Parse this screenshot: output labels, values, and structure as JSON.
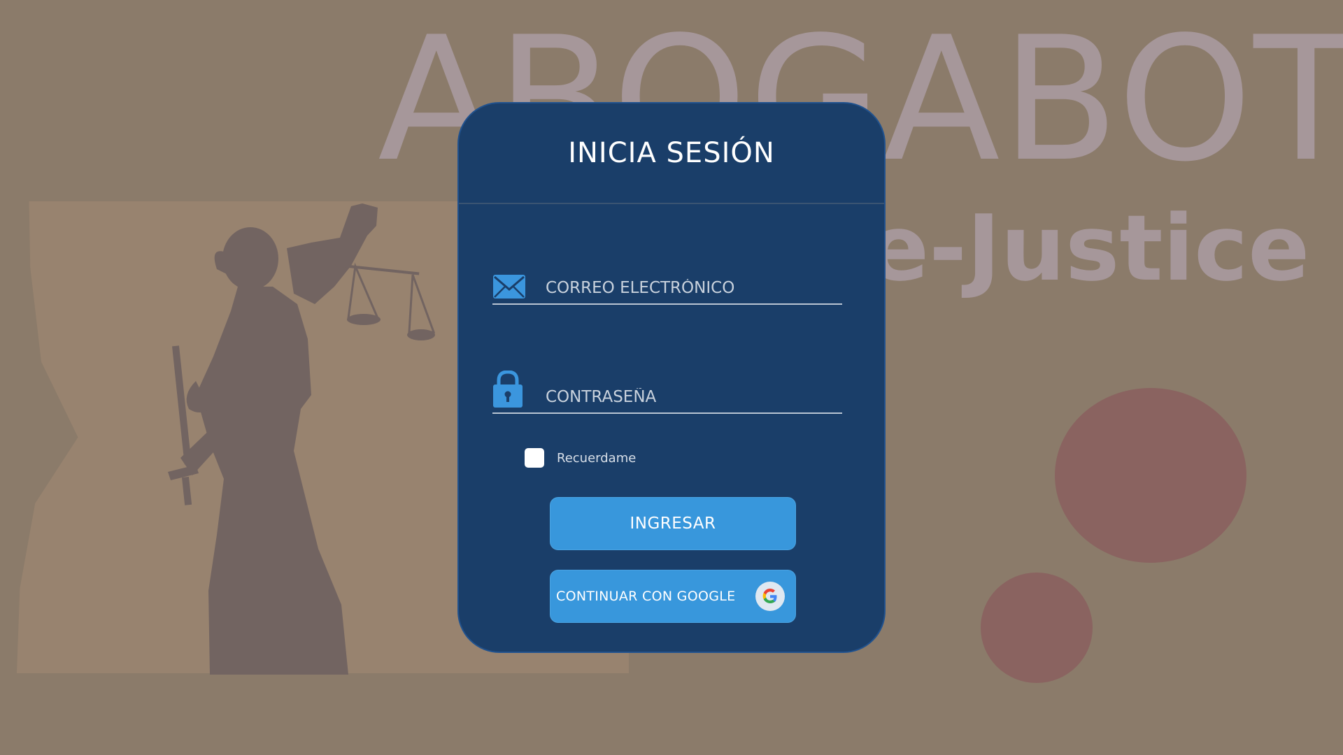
{
  "background": {
    "brand_title": "ABOGABOT",
    "brand_subtitle": "e-Justice",
    "colors": {
      "page": "#8b7b6a",
      "panel": "#98836f",
      "statue": "#726461",
      "brand_text": "#a6979a",
      "circles": "#8a6360"
    }
  },
  "login": {
    "title": "INICIA SESIÓN",
    "email": {
      "icon": "envelope-icon",
      "placeholder": "CORREO ELECTRÓNICO",
      "value": ""
    },
    "password": {
      "icon": "lock-icon",
      "placeholder": "CONTRASEÑA",
      "value": ""
    },
    "remember": {
      "label": "Recuerdame",
      "checked": false
    },
    "login_button_label": "INGRESAR",
    "google_button_label": "CONTINUAR CON GOOGLE",
    "google_icon": "google-icon",
    "colors": {
      "card": "#1a3e69",
      "button": "#3897dc",
      "icon": "#3b96de"
    }
  }
}
